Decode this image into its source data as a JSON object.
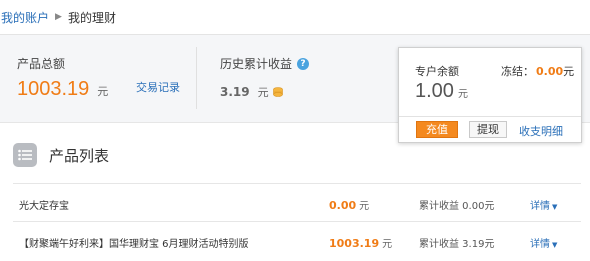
{
  "breadcrumb": {
    "parent": "我的账户",
    "separator": "▶",
    "current": "我的理财"
  },
  "summary": {
    "total_label": "产品总额",
    "total_value": "1003.19",
    "total_unit": "元",
    "trade_link": "交易记录",
    "history_label": "历史累计收益",
    "history_value": "3.19",
    "history_unit": "元"
  },
  "popup": {
    "balance_label": "专户余额",
    "frozen_label": "冻结：",
    "frozen_value": "0.00",
    "frozen_unit": "元",
    "balance_value": "1.00",
    "balance_unit": "元",
    "recharge_label": "充值",
    "withdraw_label": "提现",
    "detail_label": "收支明细"
  },
  "section": {
    "title": "产品列表"
  },
  "products": [
    {
      "name": "光大定存宝",
      "amount": "0.00",
      "unit": "元",
      "earnings": "累计收益 0.00元",
      "detail": "详情"
    },
    {
      "name": "【财聚端午好利来】国华理财宝 6月理财活动特别版",
      "amount": "1003.19",
      "unit": "元",
      "earnings": "累计收益 3.19元",
      "detail": "详情"
    }
  ],
  "colors": {
    "accent_orange": "#f07c16",
    "link_blue": "#2a6fb8"
  },
  "icons": {
    "help": "help-icon",
    "coin": "coin-icon",
    "list": "list-icon",
    "caret": "chevron-down-icon"
  }
}
